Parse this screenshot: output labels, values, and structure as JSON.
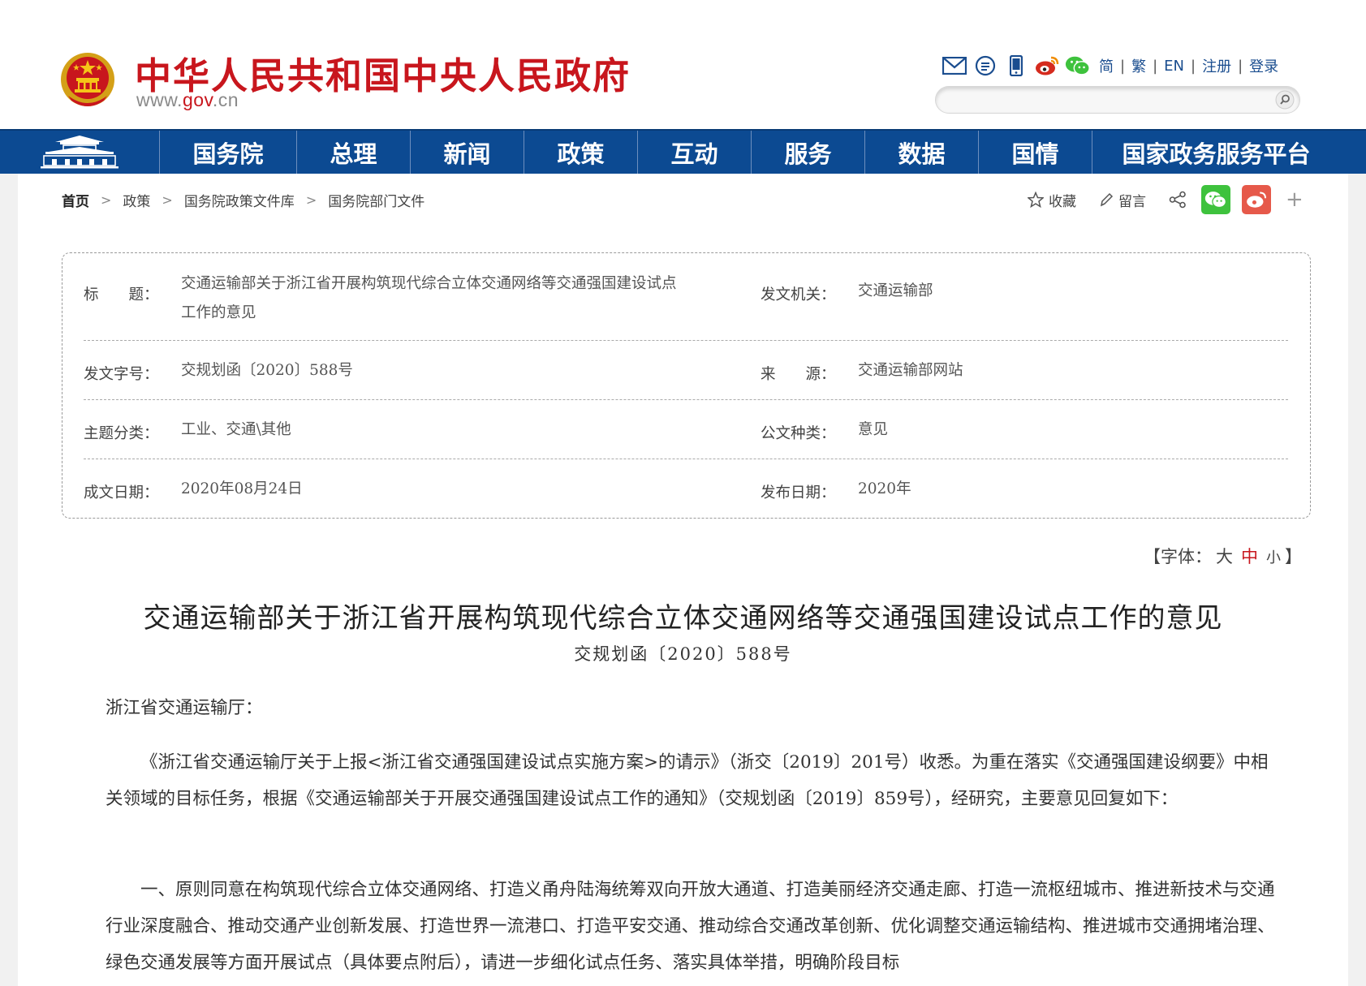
{
  "header": {
    "site_title": "中华人民共和国中央人民政府",
    "site_url_prefix": "www.",
    "site_url_brand": "gov",
    "site_url_suffix": ".cn",
    "lang_links": [
      "简",
      "繁",
      "EN",
      "注册",
      "登录"
    ],
    "search_placeholder": ""
  },
  "nav": {
    "items": [
      "国务院",
      "总理",
      "新闻",
      "政策",
      "互动",
      "服务",
      "数据",
      "国情",
      "国家政务服务平台"
    ]
  },
  "breadcrumb": [
    "首页",
    "政策",
    "国务院政策文件库",
    "国务院部门文件"
  ],
  "share": {
    "favorite": "收藏",
    "comment": "留言",
    "plus": "+"
  },
  "info": {
    "title_label": "标　　题：",
    "title_value_line1": "交通运输部关于浙江省开展构筑现代综合立体交通网络等交通强国建设试点",
    "title_value_line2": "工作的意见",
    "issuer_label": "发文机关：",
    "issuer_value": "交通运输部",
    "doc_no_label": "发文字号：",
    "doc_no_value": "交规划函〔2020〕588号",
    "source_label": "来　　源：",
    "source_value": "交通运输部网站",
    "topic_label": "主题分类：",
    "topic_value": "工业、交通\\其他",
    "doc_type_label": "公文种类：",
    "doc_type_value": "意见",
    "written_date_label": "成文日期：",
    "written_date_value": "2020年08月24日",
    "publish_date_label": "发布日期：",
    "publish_date_value": "2020年"
  },
  "font_size": {
    "open": "【字体：",
    "large": "大",
    "medium": "中",
    "small": "小",
    "close": "】"
  },
  "document": {
    "title": "交通运输部关于浙江省开展构筑现代综合立体交通网络等交通强国建设试点工作的意见",
    "number": "交规划函〔2020〕588号",
    "salutation": "浙江省交通运输厅：",
    "para1": "《浙江省交通运输厅关于上报<浙江省交通强国建设试点实施方案>的请示》（浙交〔2019〕201号）收悉。为重在落实《交通强国建设纲要》中相关领域的目标任务，根据《交通运输部关于开展交通强国建设试点工作的通知》（交规划函〔2019〕859号），经研究，主要意见回复如下：",
    "para2": "一、原则同意在构筑现代综合立体交通网络、打造义甬舟陆海统筹双向开放大通道、打造美丽经济交通走廊、打造一流枢纽城市、推进新技术与交通行业深度融合、推动交通产业创新发展、打造世界一流港口、打造平安交通、推动综合交通改革创新、优化调整交通运输结构、推进城市交通拥堵治理、绿色交通发展等方面开展试点（具体要点附后），请进一步细化试点任务、落实具体举措，明确阶段目标"
  },
  "colors": {
    "brand_red": "#c8161d",
    "nav_blue": "#0c4a92",
    "link_blue": "#1a4d8f",
    "wechat_green": "#3ec23d",
    "weibo_red": "#e6594a"
  }
}
